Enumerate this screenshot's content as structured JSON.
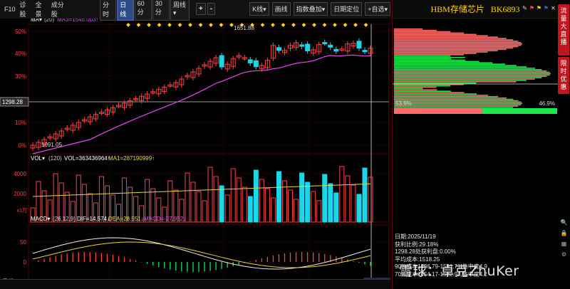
{
  "toolbar": {
    "f10": "F10",
    "diagnose": "诊股",
    "overview": "全景",
    "constituents": "成分股",
    "periods": [
      "分时",
      "日线",
      "60分",
      "30分",
      "周线▾"
    ],
    "active_period": 1,
    "plus": "+",
    "minus": "-",
    "k_type": "K线▾",
    "draw": "画线",
    "index_overlay": "指数叠加▾",
    "date_locate": "日期定位",
    "watchlist": "+自选▾"
  },
  "colors": {
    "up": "#ff4242",
    "down": "#1ad6e8",
    "ma": "#e64be6",
    "vol_ma": "#e8d84a",
    "dif": "#f0f0f0",
    "dea": "#e6d33c",
    "grid": "#4a0000",
    "sellzone": "#ff6b6b",
    "buyzone": "#18e84c",
    "accent": "#ffd400",
    "redtab": "#c0161d"
  },
  "price_panel": {
    "ma_select": "MA▾",
    "ma_period": "(20)",
    "ma_label": "MA3=1545.003↑",
    "current_price": "1298.28",
    "high_label": "1651.88",
    "low_label": "1091.05",
    "y_ticks": [
      "50%",
      "40%",
      "30%",
      "20%",
      "10%",
      "0%"
    ]
  },
  "vol_panel": {
    "select": "VOL▾",
    "params": "(120)",
    "vol_label": "VOL=363436964↑",
    "ma1_label": "MA1=287190999↑",
    "y_ticks": [
      "4000",
      "2000"
    ],
    "unit": "x1万"
  },
  "macd_panel": {
    "select": "MACD▾",
    "params": "(26,12,9)",
    "dif_label": "DIF=14.574↓",
    "dea_label": "DEA=28.551↓",
    "macd_label": "MACD=-27.952↓",
    "y_ticks": [
      "50",
      "0"
    ]
  },
  "x_axis": {
    "labels": [
      "2025/8",
      "9",
      "10",
      "11"
    ],
    "current_date": "2025/11/19",
    "corner": "日线"
  },
  "right_panel": {
    "title": "HBM存储芯片",
    "code": "BK6893",
    "pct_left": "53.9%",
    "pct_right": "46.9%",
    "ratio": 0.54,
    "side_tab_1": "流\n量\n大\n直\n播",
    "side_tab_2": "限\n时\n优\n惠",
    "info_lines": [
      "日期:2025/11/19",
      "获利比例:29.18%",
      "1298.28处获利盘:0.00%",
      "平均成本:1518.25",
      "90%成本1436.79-1591.71,集中度4.9",
      "70%成本1454.17-1582.93,集中度4.2"
    ],
    "watermark": "雪球：卓克ZhuKer"
  }
}
